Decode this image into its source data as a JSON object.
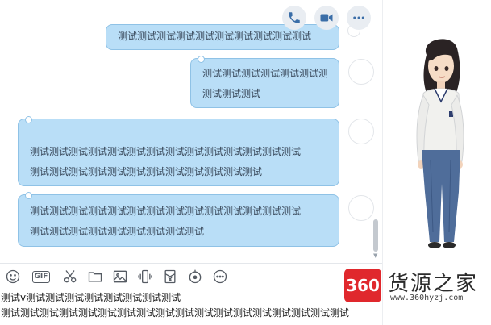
{
  "chat": {
    "messages": [
      {
        "lines": [
          "测试测试测试测试测试测试测试测试测试测试"
        ]
      },
      {
        "lines": [
          "测试测试测试测试测试测试测试",
          "测试测试测试"
        ]
      },
      {
        "lines": [
          "测试测试测试测试测试测试测试测试测试测试测试测试测试测试",
          "测试测试测试测试测试测试测试测试测试测试测试测试"
        ]
      },
      {
        "lines": [
          "测试测试测试测试测试测试测试测试测试测试测试测试测试测试",
          "测试测试测试测试测试测试测试测试测试"
        ]
      }
    ]
  },
  "toolbar": {
    "gif_label": "GIF"
  },
  "composer": {
    "line1": "测试v测试测试测试测试测试测试测试测试",
    "line2": "测试测试测试测试测试测试测试测试测试测试测试测试测试测试测试测试测试测试"
  },
  "watermark": {
    "logo": "360",
    "title": "货源之家",
    "url": "www.360hyzj.com"
  },
  "colors": {
    "bubble": "#b9def7",
    "bubble_border": "#8fc2e6",
    "logo_red": "#e0282d"
  },
  "icons": [
    "phone-icon",
    "video-call-icon",
    "more-icon",
    "emoji-icon",
    "gif-icon",
    "scissors-icon",
    "folder-icon",
    "image-icon",
    "shake-icon",
    "red-packet-icon",
    "music-icon",
    "more-tools-icon"
  ]
}
